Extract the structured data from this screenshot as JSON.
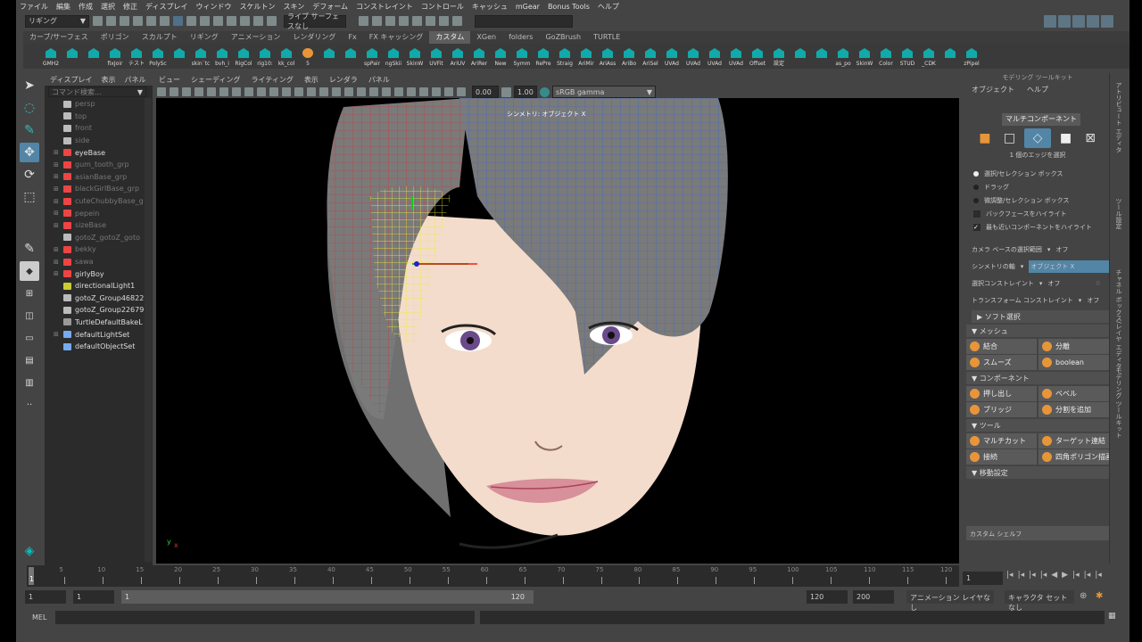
{
  "menubar": [
    "ファイル",
    "編集",
    "作成",
    "選択",
    "修正",
    "ディスプレイ",
    "ウィンドウ",
    "スケルトン",
    "スキン",
    "デフォーム",
    "コンストレイント",
    "コントロール",
    "キャッシュ",
    "mGear",
    "Bonus Tools",
    "ヘルプ"
  ],
  "status": {
    "menuset": "リギング",
    "live_surface": "ライブ サーフェスなし"
  },
  "shelf_tabs": [
    "カーブ/サーフェス",
    "ポリゴン",
    "スカルプト",
    "リギング",
    "アニメーション",
    "レンダリング",
    "Fx",
    "FX キャッシング",
    "カスタム",
    "XGen",
    "folders",
    "GoZBrush",
    "TURTLE"
  ],
  "shelf_active": "カスタム",
  "shelf_items": [
    "GMH2",
    "",
    "",
    "fixJoir",
    "テスト",
    "PolySc",
    "",
    "skin`tc",
    "bvh_i",
    "RigCol",
    "rig10:",
    "kk_col",
    "5",
    "",
    "",
    "spPair",
    "ngSkii",
    "SkinW",
    "UVFit",
    "AriUV",
    "AriRer",
    "New",
    "Symm",
    "RePre",
    "Straig",
    "AriMir",
    "AriAss",
    "AriBo",
    "AriSel",
    "UVAd",
    "UVAd",
    "UVAd",
    "UVAd",
    "Offset",
    "設定",
    "",
    "",
    "as_po",
    "SkinW",
    "Color",
    "STUD",
    "_CDK",
    "",
    "zPipel"
  ],
  "outliner": {
    "menu": [
      "ディスプレイ",
      "表示",
      "パネル"
    ],
    "search_placeholder": "コマンド検索...",
    "items": [
      {
        "name": "persp",
        "type": "camera",
        "dim": true,
        "exp": false
      },
      {
        "name": "top",
        "type": "camera",
        "dim": true,
        "exp": false
      },
      {
        "name": "front",
        "type": "camera",
        "dim": true,
        "exp": false
      },
      {
        "name": "side",
        "type": "camera",
        "dim": true,
        "exp": false
      },
      {
        "name": "eyeBase",
        "type": "group",
        "dim": false,
        "exp": true
      },
      {
        "name": "gum_tooth_grp",
        "type": "group",
        "dim": true,
        "exp": true
      },
      {
        "name": "asianBase_grp",
        "type": "group",
        "dim": true,
        "exp": true
      },
      {
        "name": "blackGirlBase_grp",
        "type": "group",
        "dim": true,
        "exp": true
      },
      {
        "name": "cuteChubbyBase_g",
        "type": "group",
        "dim": true,
        "exp": true
      },
      {
        "name": "pepein",
        "type": "group",
        "dim": true,
        "exp": true
      },
      {
        "name": "sizeBase",
        "type": "group",
        "dim": true,
        "exp": true
      },
      {
        "name": "gotoZ_gotoZ_goto",
        "type": "node",
        "dim": true,
        "exp": false
      },
      {
        "name": "bekky",
        "type": "group",
        "dim": true,
        "exp": true
      },
      {
        "name": "sawa",
        "type": "group",
        "dim": true,
        "exp": true
      },
      {
        "name": "girlyBoy",
        "type": "group",
        "dim": false,
        "exp": true
      },
      {
        "name": "directionalLight1",
        "type": "light",
        "dim": false,
        "exp": false
      },
      {
        "name": "gotoZ_Group46822",
        "type": "node",
        "dim": false,
        "exp": false
      },
      {
        "name": "gotoZ_Group22679",
        "type": "node",
        "dim": false,
        "exp": false
      },
      {
        "name": "TurtleDefaultBakeL",
        "type": "bake",
        "dim": false,
        "exp": false
      },
      {
        "name": "defaultLightSet",
        "type": "set",
        "dim": false,
        "exp": true
      },
      {
        "name": "defaultObjectSet",
        "type": "set",
        "dim": false,
        "exp": false
      }
    ]
  },
  "viewport": {
    "menu": [
      "ビュー",
      "シェーディング",
      "ライティング",
      "表示",
      "レンダラ",
      "パネル"
    ],
    "exposure": "0.00",
    "gamma": "1.00",
    "colorspace": "sRGB gamma",
    "hud_symmetry": "シンメトリ: オブジェクト X"
  },
  "toolkit": {
    "title": "モデリング ツールキット",
    "menu": [
      "オブジェクト",
      "ヘルプ"
    ],
    "multi_component": "マルチコンポーネント",
    "selection_info": "1 個のエッジを選択",
    "radios": [
      {
        "label": "選択/セレクション ボックス",
        "on": true
      },
      {
        "label": "ドラッグ",
        "on": false
      },
      {
        "label": "微調整/セレクション ボックス",
        "on": false
      }
    ],
    "checks": [
      {
        "label": "バックフェースをハイライト",
        "on": false
      },
      {
        "label": "最も近いコンポーネントをハイライト",
        "on": true
      }
    ],
    "camera_based_label": "カメラ ベースの選択範囲",
    "camera_based_value": "オフ",
    "symmetry_label": "シンメトリの軸",
    "symmetry_value": "オブジェクト X",
    "sel_constraint_label": "選択コンストレイント",
    "sel_constraint_value": "オフ",
    "sel_constraint_num": "0",
    "xform_constraint_label": "トランスフォーム コンストレイント",
    "xform_constraint_value": "オフ",
    "soft_select": "ソフト選択",
    "mesh_header": "メッシュ",
    "mesh": [
      "結合",
      "分離",
      "スムーズ",
      "boolean"
    ],
    "component_header": "コンポーネント",
    "component": [
      "押し出し",
      "ベベル",
      "ブリッジ",
      "分割を追加"
    ],
    "tools_header": "ツール",
    "tools": [
      "マルチカット",
      "ターゲット連結",
      "接続",
      "四角ポリゴン描画"
    ],
    "move_header": "移動設定",
    "custom_shelf": "カスタム シェルフ"
  },
  "side_tabs": [
    "アトリビュート エディタ",
    "ツール設定",
    "チャネル ボックス/レイヤ エディタ",
    "モデリング ツールキット"
  ],
  "timeline": {
    "ticks": [
      "5",
      "10",
      "15",
      "20",
      "25",
      "30",
      "35",
      "40",
      "45",
      "50",
      "55",
      "60",
      "65",
      "70",
      "75",
      "80",
      "85",
      "90",
      "95",
      "100",
      "105",
      "110",
      "115",
      "120"
    ],
    "current": "1",
    "current_field": "1"
  },
  "range": {
    "start": "1",
    "start2": "1",
    "slider_start": "1",
    "slider_end": "120",
    "end": "120",
    "end2": "200",
    "anim_layer": "アニメーション レイヤなし",
    "char_set": "キャラクタ セットなし"
  },
  "mel": {
    "label": "MEL"
  }
}
